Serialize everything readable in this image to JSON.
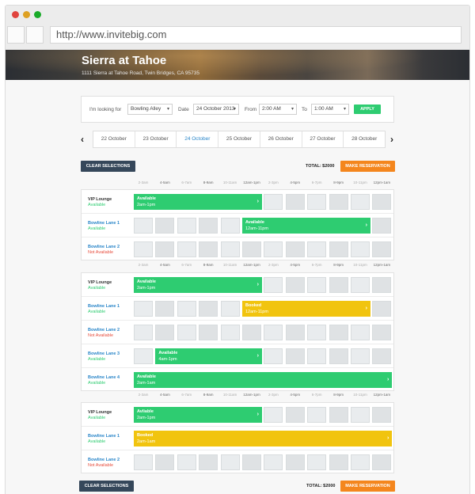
{
  "browser": {
    "url": "http://www.invitebig.com"
  },
  "venue": {
    "name": "Sierra at Tahoe",
    "address": "1111 Sierra at Tahoe Road, Twin Bridges, CA 95735"
  },
  "filter": {
    "looking_label": "I'm looking for",
    "looking_value": "Bowling Alley",
    "date_label": "Date",
    "date_value": "24 October 2013",
    "from_label": "From",
    "from_value": "2:00 AM",
    "to_label": "To",
    "to_value": "1:00 AM",
    "apply_label": "APPLY"
  },
  "dates": [
    "22 October",
    "23 October",
    "24 October",
    "25 October",
    "26 October",
    "27 October",
    "28 October"
  ],
  "active_date_index": 2,
  "actions": {
    "clear_label": "CLEAR SELECTIONS",
    "total_label": "TOTAL: $2000",
    "reserve_label": "MAKE RESERVATION"
  },
  "time_ticks": [
    "2-3am",
    "4-5am",
    "6-7am",
    "8-9am",
    "10-11am",
    "12am-1pm",
    "2-3pm",
    "4-5pm",
    "6-7pm",
    "8-9pm",
    "10-11pm",
    "12pm-1am"
  ],
  "blocks": [
    {
      "rows": [
        {
          "name": "VIP Lounge",
          "status": "Available",
          "status_type": "ok",
          "kind": "vip",
          "bar": {
            "label": "Available",
            "time": "2am-1pm",
            "color": "g",
            "start": 0,
            "span": 6
          }
        },
        {
          "name": "Bowline Lane 1",
          "status": "Available",
          "status_type": "ok",
          "kind": "lane",
          "bar": {
            "label": "Available",
            "time": "12am-11pm",
            "color": "g",
            "start": 5,
            "span": 6
          }
        },
        {
          "name": "Bowline Lane 2",
          "status": "Not Available",
          "status_type": "no",
          "kind": "lane",
          "bar": null
        }
      ]
    },
    {
      "rows": [
        {
          "name": "VIP Lounge",
          "status": "Available",
          "status_type": "ok",
          "kind": "vip",
          "bar": {
            "label": "Available",
            "time": "2am-1pm",
            "color": "g",
            "start": 0,
            "span": 6
          }
        },
        {
          "name": "Bowline Lane 1",
          "status": "Available",
          "status_type": "ok",
          "kind": "lane",
          "bar": {
            "label": "Booked",
            "time": "12am-11pm",
            "color": "y",
            "start": 5,
            "span": 6
          }
        },
        {
          "name": "Bowline Lane 2",
          "status": "Not Available",
          "status_type": "no",
          "kind": "lane",
          "bar": null
        },
        {
          "name": "Bowline Lane 3",
          "status": "Available",
          "status_type": "ok",
          "kind": "lane",
          "bar": {
            "label": "Available",
            "time": "4am-1pm",
            "color": "g",
            "start": 1,
            "span": 5
          }
        },
        {
          "name": "Bowline Lane 4",
          "status": "Available",
          "status_type": "ok",
          "kind": "lane",
          "bar": {
            "label": "Available",
            "time": "2am-1am",
            "color": "g",
            "start": 0,
            "span": 12
          }
        }
      ]
    },
    {
      "rows": [
        {
          "name": "VIP Lounge",
          "status": "Available",
          "status_type": "ok",
          "kind": "vip",
          "bar": {
            "label": "Avliable",
            "time": "2am-1pm",
            "color": "g",
            "start": 0,
            "span": 6
          }
        },
        {
          "name": "Bowline Lane 1",
          "status": "Available",
          "status_type": "ok",
          "kind": "lane",
          "bar": {
            "label": "Booked",
            "time": "2am-1am",
            "color": "y",
            "start": 0,
            "span": 12
          }
        },
        {
          "name": "Bowline Lane 2",
          "status": "Not Available",
          "status_type": "no",
          "kind": "lane",
          "bar": null
        }
      ]
    }
  ],
  "colors": {
    "green": "#2ecc71",
    "yellow": "#f1c40f",
    "orange": "#f4861d",
    "navy": "#35475a",
    "link": "#2a86c9"
  }
}
